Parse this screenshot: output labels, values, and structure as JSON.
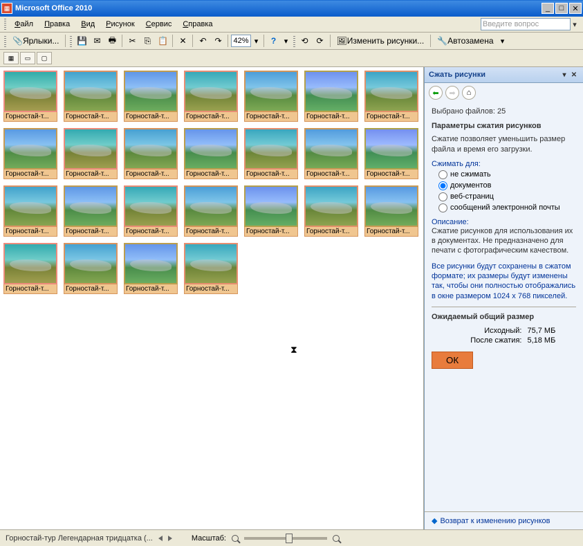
{
  "title": "Microsoft Office 2010",
  "menu": [
    "Файл",
    "Правка",
    "Вид",
    "Рисунок",
    "Сервис",
    "Справка"
  ],
  "question_placeholder": "Введите вопрос",
  "toolbar": {
    "shortcuts_label": "Ярлыки...",
    "zoom": "42%",
    "edit_pictures_label": "Изменить рисунки...",
    "autoreplace_label": "Автозамена"
  },
  "thumbs": [
    "Горностай-т...",
    "Горностай-т...",
    "Горностай-т...",
    "Горностай-т...",
    "Горностай-т...",
    "Горностай-т...",
    "Горностай-т...",
    "Горностай-т...",
    "Горностай-т...",
    "Горностай-т...",
    "Горностай-т...",
    "Горностай-т...",
    "Горностай-т...",
    "Горностай-т...",
    "Горностай-т...",
    "Горностай-т...",
    "Горностай-т...",
    "Горностай-т...",
    "Горностай-т...",
    "Горностай-т...",
    "Горностай-т...",
    "Горностай-т...",
    "Горностай-т...",
    "Горностай-т...",
    "Горностай-т..."
  ],
  "panel": {
    "title": "Сжать рисунки",
    "selected_files": "Выбрано файлов:  25",
    "params_title": "Параметры сжатия рисунков",
    "params_desc": "Сжатие позволяет уменьшить размер файла и время его загрузки.",
    "compress_for": "Сжимать для:",
    "radios": [
      "не сжимать",
      "документов",
      "веб-страниц",
      "сообщений электронной почты"
    ],
    "selected_radio": 1,
    "description_label": "Описание:",
    "description_text": "Сжатие рисунков для использования их в документах. Не предназначено для печати с фотографическим качеством.",
    "note_text": "Все рисунки будут сохранены в сжатом формате; их размеры будут изменены так, чтобы они полностью отображались в окне размером 1024 x 768 пикселей.",
    "expected_title": "Ожидаемый общий размер",
    "original_label": "Исходный:",
    "original_value": "75,7 МБ",
    "after_label": "После сжатия:",
    "after_value": "5,18 МБ",
    "ok": "ОК",
    "return_link": "Возврат к изменению рисунков"
  },
  "status": {
    "filename": "Горностай-тур Легендарная тридцатка  (...",
    "zoom_label": "Масштаб:"
  }
}
